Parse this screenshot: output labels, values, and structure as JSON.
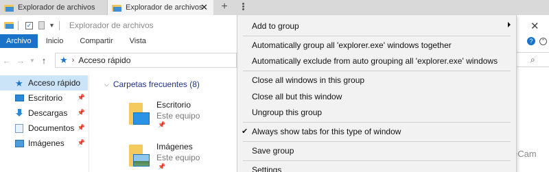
{
  "tabs": [
    {
      "label": "Explorador de archivos",
      "active": false
    },
    {
      "label": "Explorador de archivos",
      "active": true,
      "close_glyph": "✕"
    }
  ],
  "new_tab_glyph": "+",
  "quick_access_toolbar": {
    "title": "Explorador de archivos"
  },
  "ribbon_tabs": [
    "Archivo",
    "Inicio",
    "Compartir",
    "Vista"
  ],
  "address_bar": {
    "path": "Acceso rápido"
  },
  "nav_pane": {
    "items": [
      {
        "label": "Acceso rápido",
        "icon": "quick-access-star-icon",
        "pinned": false,
        "selected": true
      },
      {
        "label": "Escritorio",
        "icon": "desktop-icon",
        "pinned": true
      },
      {
        "label": "Descargas",
        "icon": "downloads-icon",
        "pinned": true
      },
      {
        "label": "Documentos",
        "icon": "documents-icon",
        "pinned": true
      },
      {
        "label": "Imágenes",
        "icon": "pictures-icon",
        "pinned": true
      }
    ]
  },
  "content": {
    "group_header": "Carpetas frecuentes (8)",
    "folders": [
      {
        "name": "Escritorio",
        "location": "Este equipo"
      },
      {
        "name": "Imágenes",
        "location": "Este equipo"
      }
    ]
  },
  "window": {
    "close_glyph": "✕",
    "help_glyph": "?",
    "ribbon_toggle_glyph": "⌃",
    "search_glyph": "⌕"
  },
  "watermark": "eCam",
  "context_menu": {
    "items": [
      {
        "label": "Add to group",
        "submenu": true
      },
      {
        "label": "Automatically group all 'explorer.exe' windows together"
      },
      {
        "label": "Automatically exclude from auto grouping all 'explorer.exe' windows"
      },
      {
        "label": "Close all windows in this group"
      },
      {
        "label": "Close all but this window"
      },
      {
        "label": "Ungroup this group"
      },
      {
        "label": "Always show tabs for this type of window",
        "checked": true
      },
      {
        "label": "Save group"
      },
      {
        "label": "Settings"
      }
    ],
    "check_glyph": "✔"
  },
  "colors": {
    "accent": "#1a73c9",
    "menu_background": "#f2f2f2",
    "selection": "#cce4f7",
    "tabstrip": "#d9d9d9"
  }
}
